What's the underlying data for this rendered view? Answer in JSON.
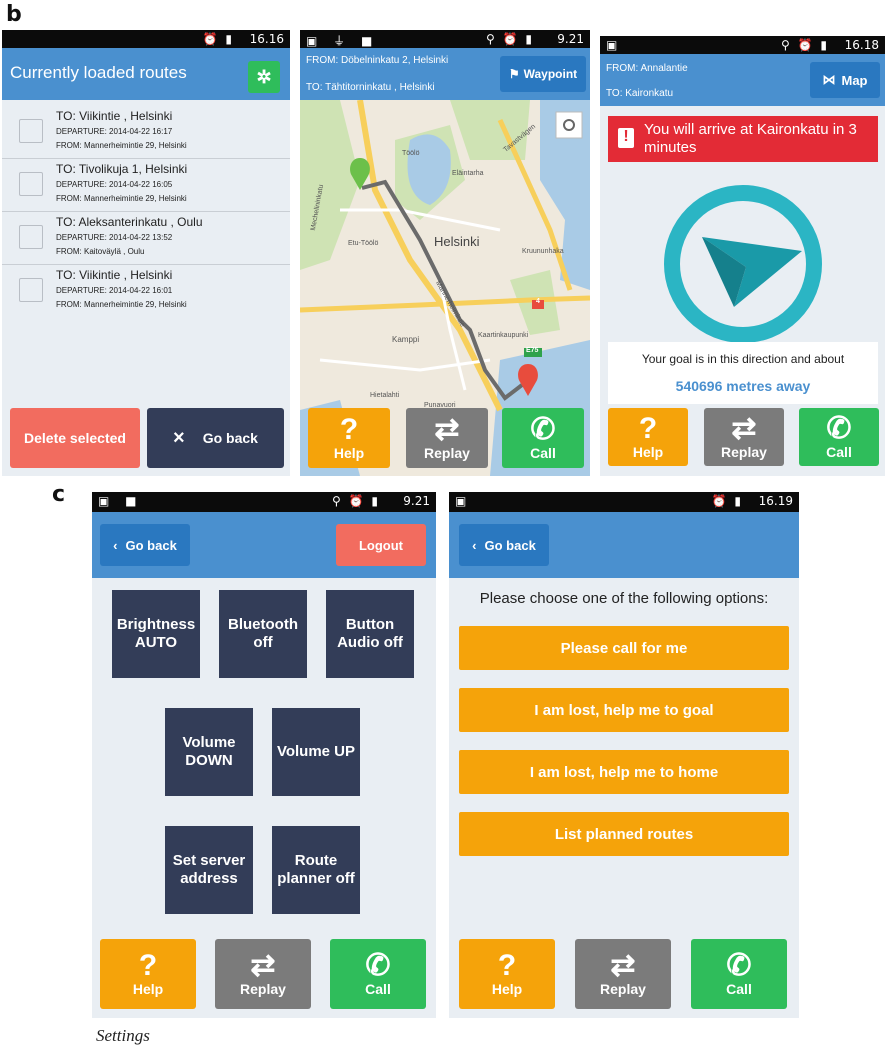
{
  "labels": {
    "b": "b",
    "c": "c",
    "caption": "Settings"
  },
  "screen1": {
    "status_time": "16.16",
    "title": "Currently loaded routes",
    "settings_icon": "gear-icon",
    "routes": [
      {
        "to": "TO: Viikintie , Helsinki",
        "departure": "DEPARTURE: 2014-04-22 16:17",
        "from": "FROM: Mannerheimintie 29, Helsinki"
      },
      {
        "to": "TO: Tivolikuja 1, Helsinki",
        "departure": "DEPARTURE: 2014-04-22 16:05",
        "from": "FROM: Mannerheimintie 29, Helsinki"
      },
      {
        "to": "TO: Aleksanterinkatu , Oulu",
        "departure": "DEPARTURE: 2014-04-22 13:52",
        "from": "FROM: Kaitoväylä , Oulu"
      },
      {
        "to": "TO: Viikintie , Helsinki",
        "departure": "DEPARTURE: 2014-04-22 16:01",
        "from": "FROM: Mannerheimintie 29, Helsinki"
      }
    ],
    "delete_label": "Delete selected",
    "goback_label": "Go back",
    "goback_icon": "×"
  },
  "screen2": {
    "status_time": "9.21",
    "from": "FROM: Döbelninkatu 2, Helsinki",
    "to": "TO: Tähtitorninkatu , Helsinki",
    "waypoint_label": "Waypoint",
    "map_labels": {
      "city": "Helsinki",
      "toolo": "Töölö",
      "elaintarha": "Eläintarha",
      "tavastvagen": "Tavastvägen",
      "etutoolo": "Etu-Töölö",
      "kruununhaka": "Kruununhaka",
      "kamppi": "Kamppi",
      "kaartinkaupunki": "Kaartinkaupunki",
      "hietalahti": "Hietalahti",
      "punavuori": "Punavuori",
      "mechelininkatu": "Mechelininkatu",
      "mannerheimintie": "Mannerheimintie",
      "route4": "4",
      "e75": "E75"
    }
  },
  "screen3": {
    "status_time": "16.18",
    "from": "FROM: Annalantie",
    "to": "TO: Kaironkatu",
    "map_label": "Map",
    "alert": "You will arrive at Kaironkatu in 3 minutes",
    "goal_text": "Your goal is in this direction and about",
    "distance": "540696 metres away",
    "compass_color": "#2bb5c4",
    "arrow_color": "#1a9aa8"
  },
  "bottom": {
    "help": "Help",
    "replay": "Replay",
    "call": "Call"
  },
  "screen4": {
    "status_time": "9.21",
    "goback_label": "Go back",
    "logout_label": "Logout",
    "tiles": [
      {
        "l1": "Brightness",
        "l2": "AUTO"
      },
      {
        "l1": "Bluetooth",
        "l2": "off"
      },
      {
        "l1": "Button",
        "l2": "Audio off"
      },
      {
        "l1": "Volume",
        "l2": "DOWN"
      },
      {
        "l1": "Volume UP",
        "l2": ""
      },
      {
        "l1": "Set server",
        "l2": "address"
      },
      {
        "l1": "Route",
        "l2": "planner off"
      }
    ]
  },
  "screen5": {
    "status_time": "16.19",
    "goback_label": "Go back",
    "prompt": "Please choose one of the following options:",
    "options": [
      "Please call for me",
      "I am lost, help me to goal",
      "I am lost, help me to home",
      "List planned routes"
    ]
  },
  "colors": {
    "blue": "#4a90cf",
    "orange": "#f5a30a",
    "green": "#2fbd5b",
    "grey": "#7b7b7b",
    "red": "#f26c5f",
    "navy": "#333d58",
    "alert_red": "#e32b36"
  }
}
